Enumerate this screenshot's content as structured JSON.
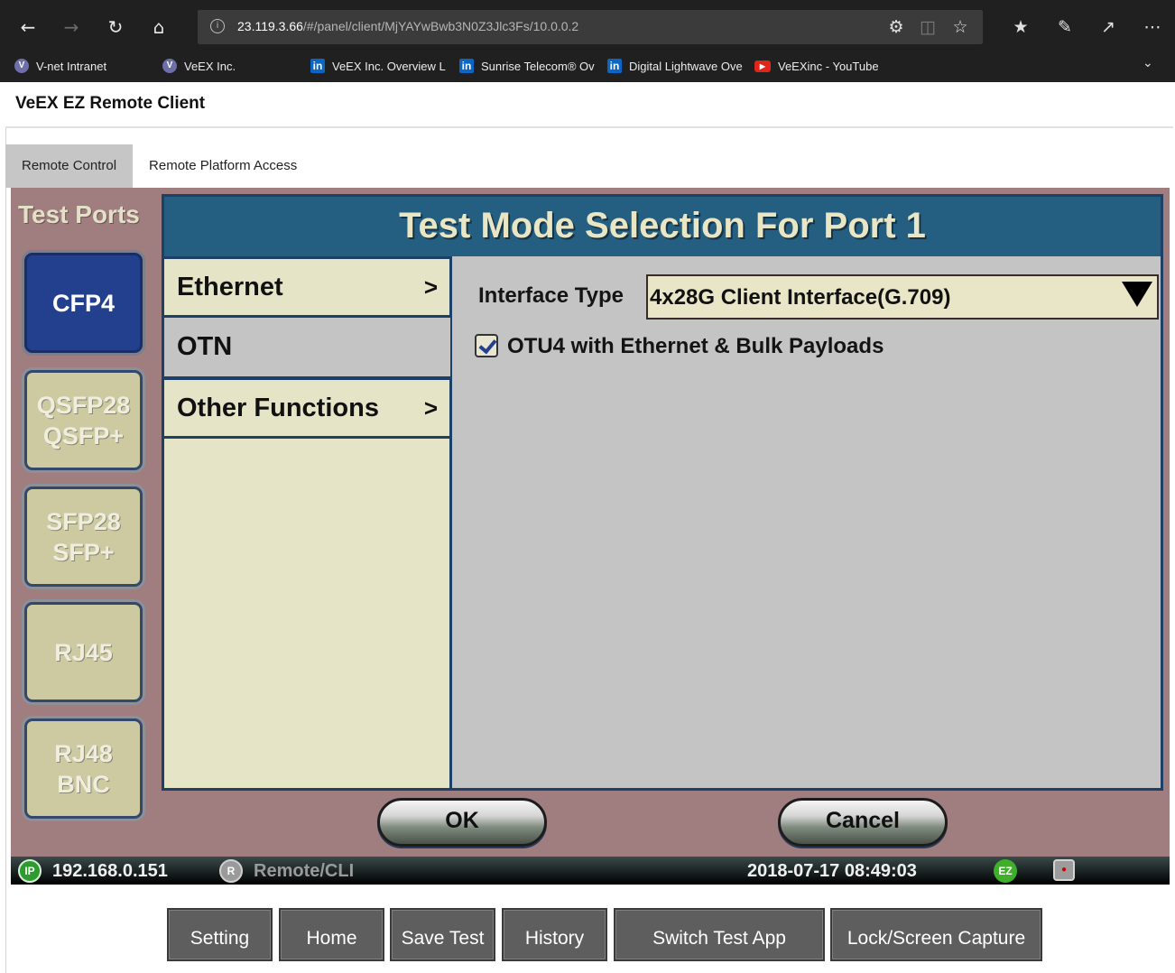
{
  "browser": {
    "url_host": "23.119.3.66",
    "url_path": "/#/panel/client/MjYAYwBwb3N0Z3Jlc3Fs/10.0.0.2",
    "favorites": [
      {
        "label": "V-net Intranet",
        "icon": "veex-logo-icon"
      },
      {
        "label": "VeEX Inc.",
        "icon": "veex-logo-icon"
      },
      {
        "label": "VeEX Inc. Overview L",
        "icon": "linkedin-icon"
      },
      {
        "label": "Sunrise Telecom® Ov",
        "icon": "linkedin-icon"
      },
      {
        "label": "Digital Lightwave Ove",
        "icon": "linkedin-icon"
      },
      {
        "label": "VeEXinc - YouTube",
        "icon": "youtube-icon"
      }
    ]
  },
  "app": {
    "title": "VeEX EZ Remote Client",
    "tabs": [
      {
        "label": "Remote Control",
        "active": true
      },
      {
        "label": "Remote Platform Access",
        "active": false
      }
    ]
  },
  "ports": {
    "title": "Test Ports",
    "items": [
      {
        "line1": "CFP4",
        "line2": "",
        "active": true
      },
      {
        "line1": "QSFP28",
        "line2": "QSFP+",
        "active": false
      },
      {
        "line1": "SFP28",
        "line2": "SFP+",
        "active": false
      },
      {
        "line1": "RJ45",
        "line2": "",
        "active": false
      },
      {
        "line1": "RJ48",
        "line2": "BNC",
        "active": false
      }
    ]
  },
  "dialog": {
    "title": "Test Mode Selection For Port 1",
    "menu": [
      {
        "label": "Ethernet",
        "arrow": ">"
      },
      {
        "label": "OTN",
        "arrow": ""
      },
      {
        "label": "Other Functions",
        "arrow": ">"
      }
    ],
    "interface_label": "Interface Type",
    "interface_value": "4x28G Client Interface(G.709)",
    "checkbox_label": "OTU4 with Ethernet & Bulk Payloads",
    "checkbox_checked": true,
    "ok_label": "OK",
    "cancel_label": "Cancel"
  },
  "status": {
    "ip": "192.168.0.151",
    "ip_badge": "IP",
    "remote_badge": "R",
    "remote": "Remote/CLI",
    "datetime": "2018-07-17  08:49:03",
    "ez_badge": "EZ"
  },
  "toolbar": {
    "setting": "Setting",
    "home": "Home",
    "save_test": "Save Test",
    "history": "History",
    "switch_app": "Switch Test App",
    "lock_capture": "Lock/Screen Capture"
  },
  "colors": {
    "screen_bg": "#a07e80",
    "dialog_title_bg": "#245f82",
    "active_port": "#23408f",
    "menu_bg": "#e6e4c6"
  }
}
